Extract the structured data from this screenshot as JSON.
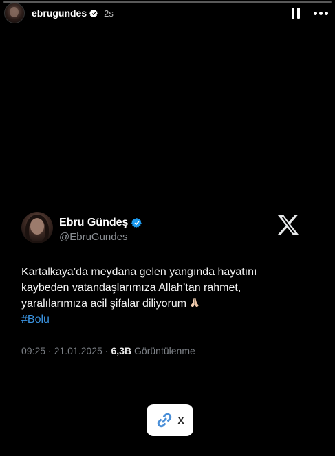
{
  "story": {
    "username": "ebrugundes",
    "time_ago": "2s"
  },
  "tweet": {
    "display_name": "Ebru Gündeş",
    "handle": "@EbruGundes",
    "text_lines": [
      "Kartalkaya’da meydana gelen yangında hayatını",
      "kaybeden vatandaşlarımıza Allah’tan rahmet,",
      "yaralılarımıza acil şifalar diliyorum"
    ],
    "hashtag": "#Bolu",
    "time": "09:25",
    "date": "21.01.2025",
    "separator": "·",
    "views": "6,3B",
    "views_label": "Görüntülenme"
  },
  "link_sticker": {
    "label": "X"
  },
  "colors": {
    "background": "#000000",
    "verified": "#1d9bf0",
    "hashtag": "#3a93e0",
    "link_icon": "#4a8fd8"
  },
  "icons": [
    "pause-icon",
    "more-icon",
    "verified-icon",
    "x-logo-icon",
    "link-icon",
    "pray-emoji-icon"
  ]
}
